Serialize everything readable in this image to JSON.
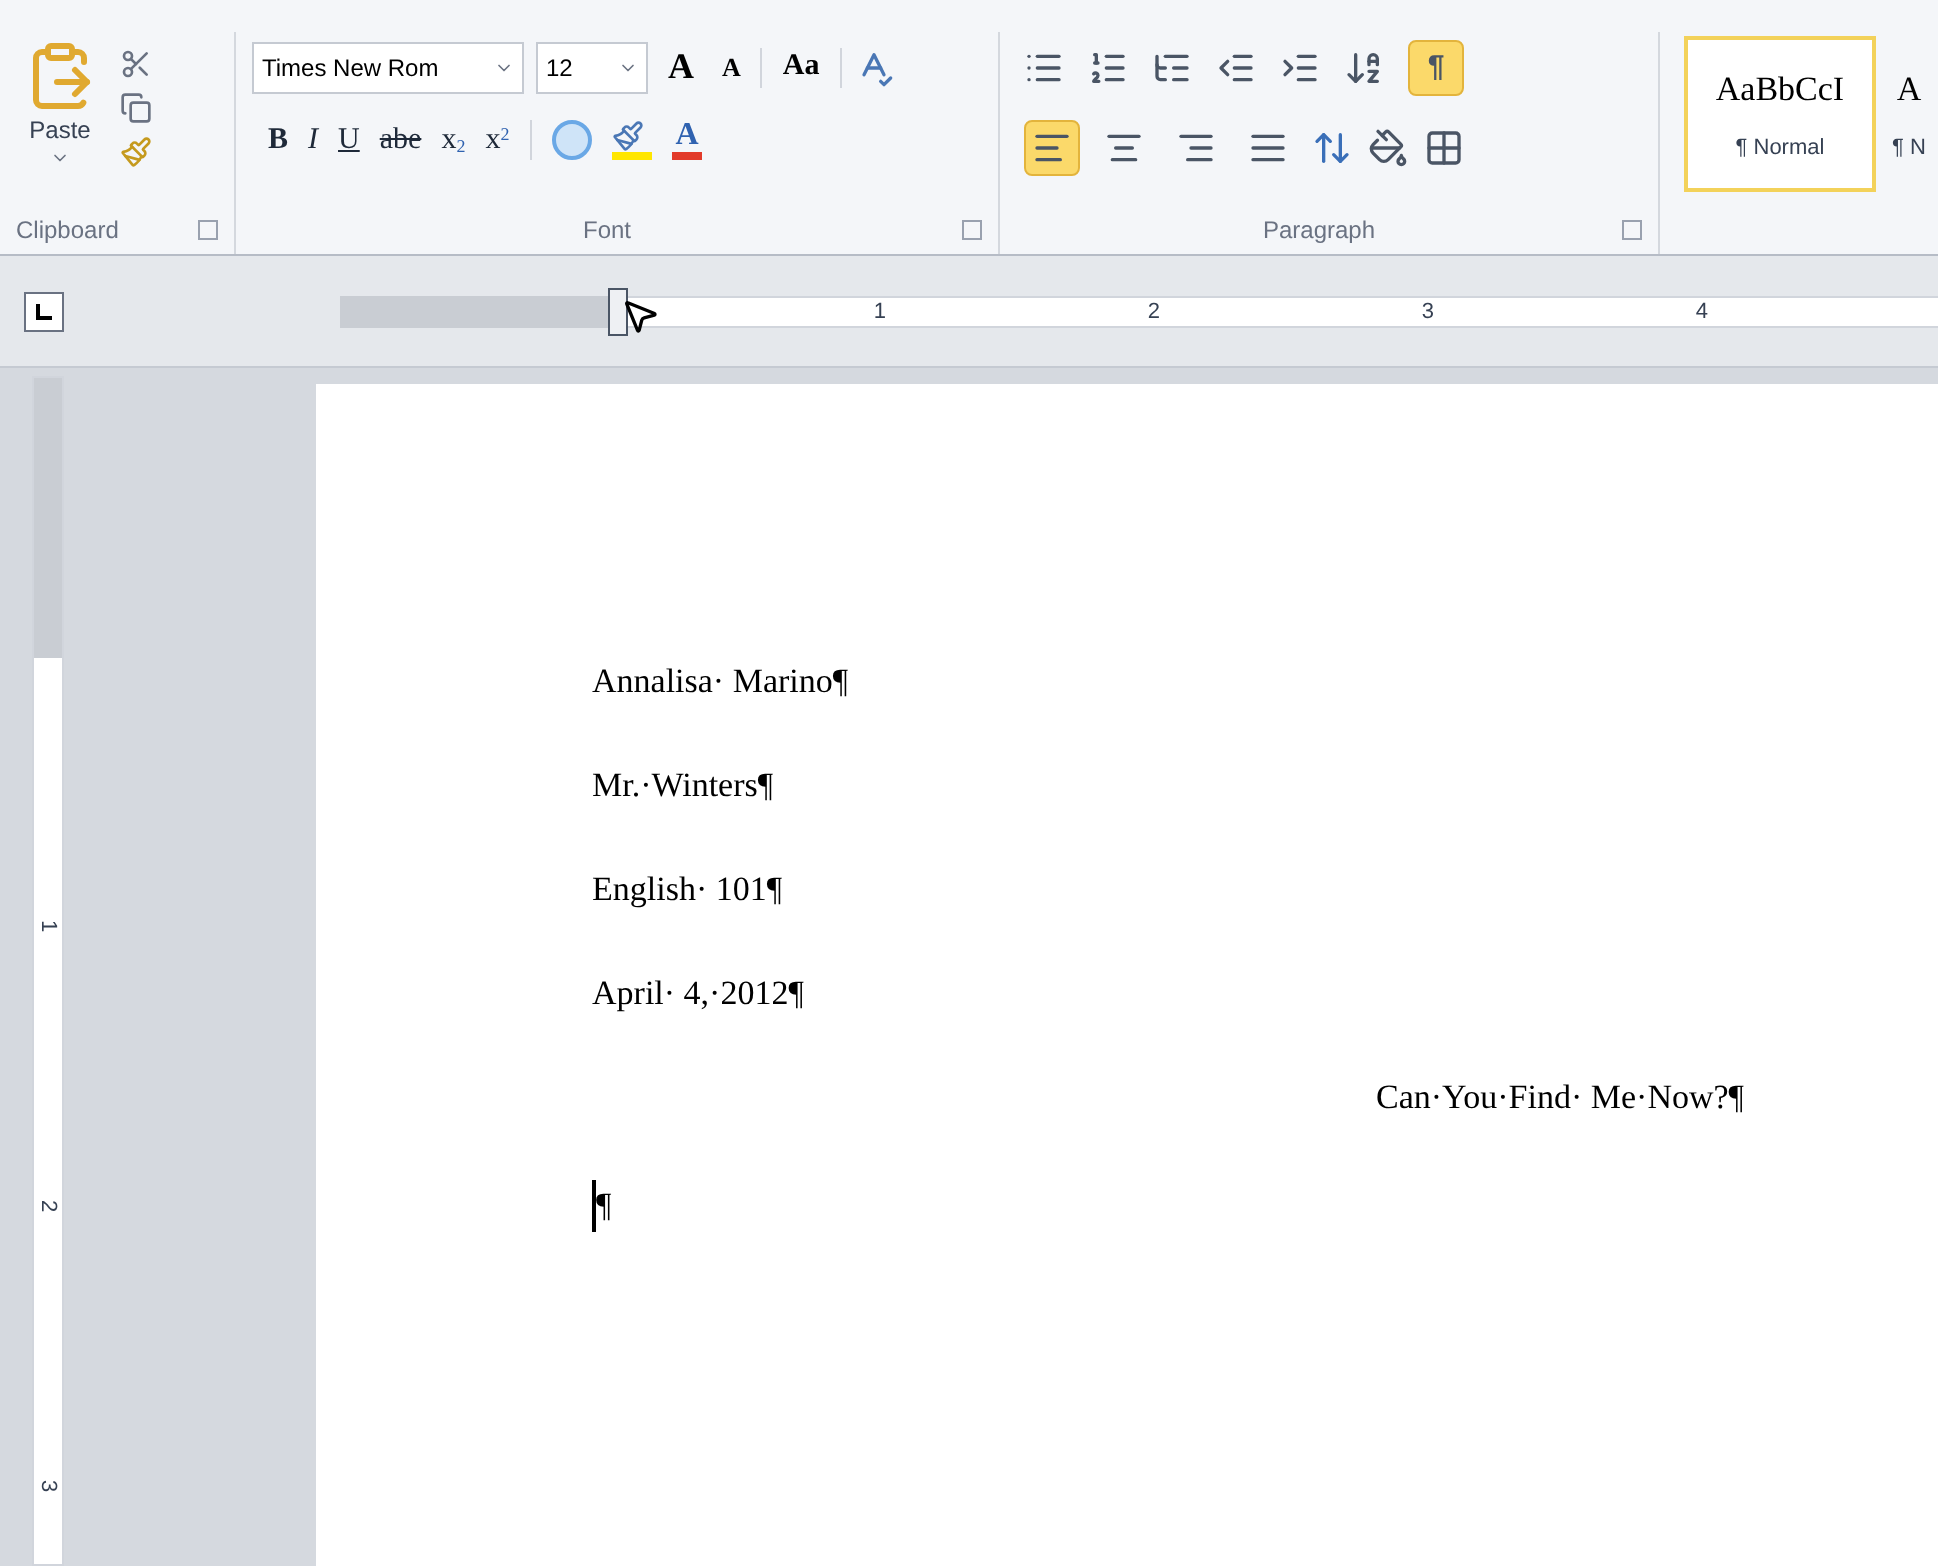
{
  "ribbon": {
    "clipboard": {
      "paste_label": "Paste",
      "group_label": "Clipboard"
    },
    "font": {
      "font_name": "Times New Rom",
      "font_size": "12",
      "grow": "A",
      "shrink": "A",
      "change_case": "Aa",
      "format_buttons": [
        {
          "kind": "bold",
          "label": "B"
        },
        {
          "kind": "italic",
          "label": "I"
        },
        {
          "kind": "underline",
          "label": "U"
        },
        {
          "kind": "strike",
          "label": "abe"
        },
        {
          "kind": "sub",
          "label": "x",
          "mark": "2"
        },
        {
          "kind": "sup",
          "label": "x",
          "mark": "2"
        }
      ],
      "color_label": "A",
      "group_label": "Font"
    },
    "paragraph": {
      "show_marks": {
        "label": "¶",
        "selected": true
      },
      "alignments": [
        {
          "kind": "left",
          "selected": true
        },
        {
          "kind": "center",
          "selected": false
        },
        {
          "kind": "right",
          "selected": false
        },
        {
          "kind": "justify",
          "selected": false
        }
      ],
      "group_label": "Paragraph"
    },
    "styles": [
      {
        "sample": "AaBbCcI",
        "name": "¶ Normal",
        "selected": true
      },
      {
        "sample": "A",
        "name": "¶ N",
        "selected": false
      }
    ]
  },
  "ruler": {
    "numbers": [
      "1",
      "2",
      "3",
      "4"
    ]
  },
  "vertical_ruler": {
    "numbers": [
      "1",
      "2",
      "3"
    ]
  },
  "document": {
    "paragraphs": [
      {
        "text": "Annalisa· Marino¶",
        "kind": "left"
      },
      {
        "text": "Mr.·Winters¶",
        "kind": "left"
      },
      {
        "text": "English· 101¶",
        "kind": "left"
      },
      {
        "text": "April· 4,·2012¶",
        "kind": "left"
      },
      {
        "text": "Can·You·Find· Me·Now?¶",
        "kind": "right"
      },
      {
        "text": "¶",
        "kind": "left",
        "cursor": true
      }
    ]
  }
}
